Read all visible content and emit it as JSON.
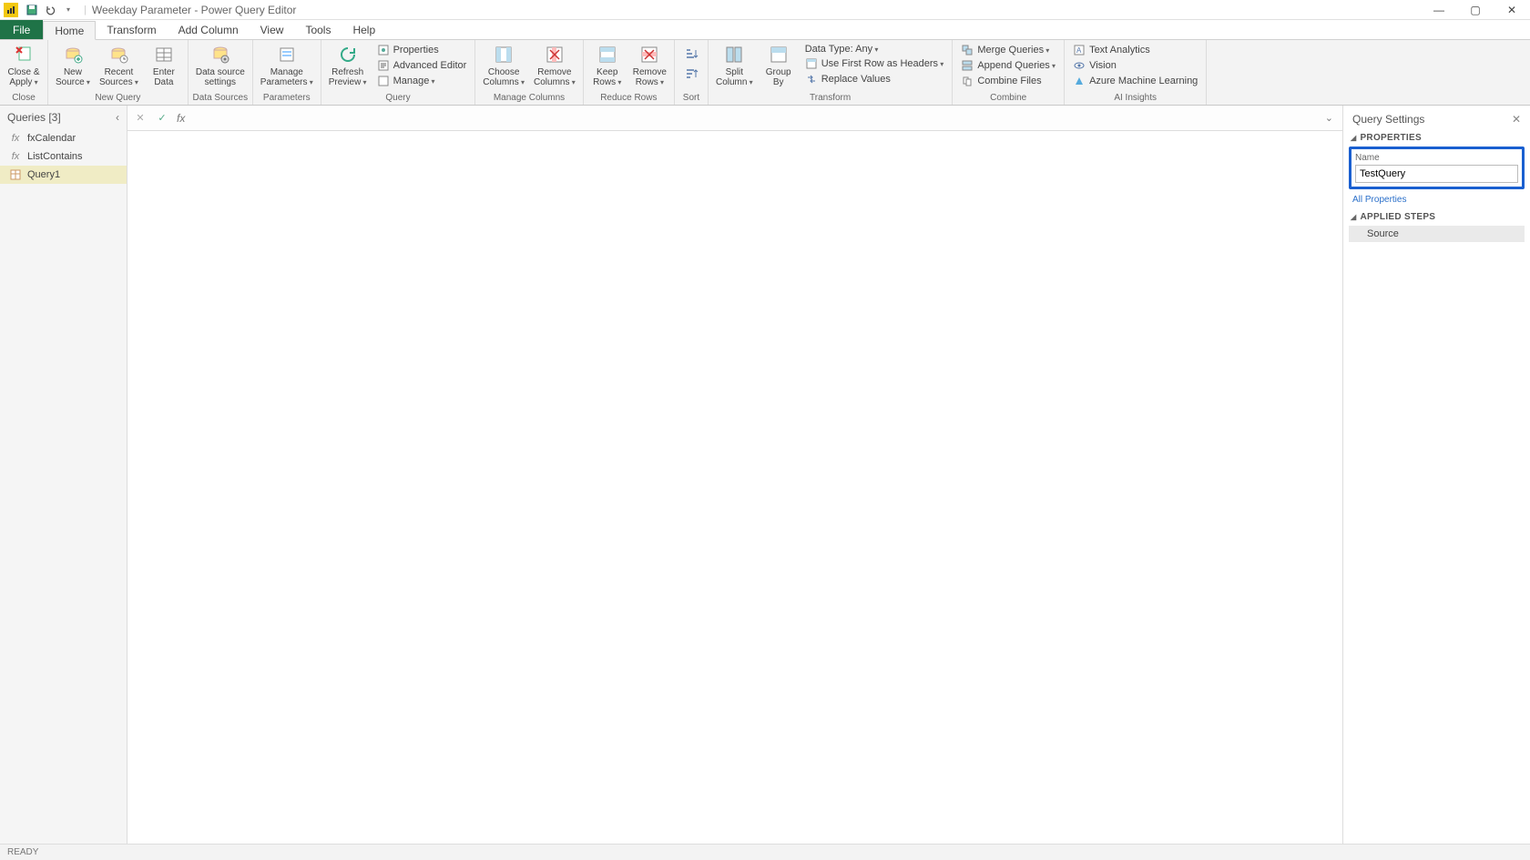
{
  "titlebar": {
    "title": "Weekday Parameter - Power Query Editor"
  },
  "tabs": {
    "file": "File",
    "home": "Home",
    "transform": "Transform",
    "add_column": "Add Column",
    "view": "View",
    "tools": "Tools",
    "help": "Help"
  },
  "ribbon": {
    "close_apply": "Close &\nApply",
    "new_source": "New\nSource",
    "recent_sources": "Recent\nSources",
    "enter_data": "Enter\nData",
    "data_source_settings": "Data source\nsettings",
    "manage_parameters": "Manage\nParameters",
    "refresh_preview": "Refresh\nPreview",
    "properties": "Properties",
    "advanced_editor": "Advanced Editor",
    "manage": "Manage",
    "choose_columns": "Choose\nColumns",
    "remove_columns": "Remove\nColumns",
    "keep_rows": "Keep\nRows",
    "remove_rows": "Remove\nRows",
    "split_column": "Split\nColumn",
    "group_by": "Group\nBy",
    "data_type": "Data Type: Any",
    "first_row_headers": "Use First Row as Headers",
    "replace_values": "Replace Values",
    "merge_queries": "Merge Queries",
    "append_queries": "Append Queries",
    "combine_files": "Combine Files",
    "text_analytics": "Text Analytics",
    "vision": "Vision",
    "azure_ml": "Azure Machine Learning",
    "groups": {
      "close": "Close",
      "new_query": "New Query",
      "data_sources": "Data Sources",
      "parameters": "Parameters",
      "query": "Query",
      "manage_columns": "Manage Columns",
      "reduce_rows": "Reduce Rows",
      "sort": "Sort",
      "transform": "Transform",
      "combine": "Combine",
      "ai_insights": "AI Insights"
    }
  },
  "queries": {
    "header": "Queries [3]",
    "items": [
      {
        "name": "fxCalendar",
        "type": "fx"
      },
      {
        "name": "ListContains",
        "type": "fx"
      },
      {
        "name": "Query1",
        "type": "table"
      }
    ]
  },
  "formula_bar": {
    "value": ""
  },
  "settings": {
    "header": "Query Settings",
    "properties_hdr": "PROPERTIES",
    "name_label": "Name",
    "name_value": "TestQuery",
    "all_properties": "All Properties",
    "applied_steps_hdr": "APPLIED STEPS",
    "steps": [
      "Source"
    ]
  },
  "statusbar": {
    "text": "READY"
  }
}
